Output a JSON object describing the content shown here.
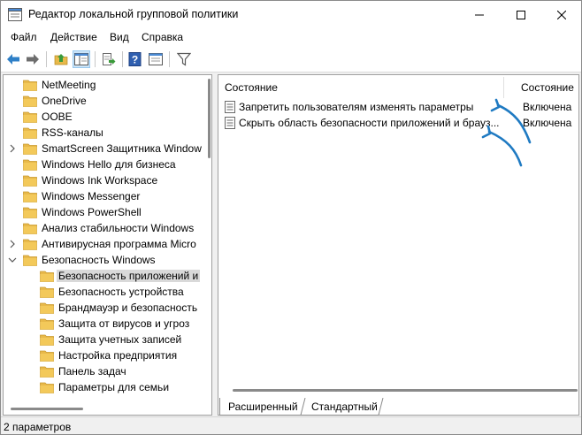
{
  "window": {
    "title": "Редактор локальной групповой политики"
  },
  "menu": [
    "Файл",
    "Действие",
    "Вид",
    "Справка"
  ],
  "toolbar": {
    "icons": [
      "back-arrow",
      "forward-arrow",
      "up-folder",
      "show-hide-tree",
      "export-list",
      "help",
      "extended-view",
      "filter"
    ]
  },
  "tree": {
    "items": [
      {
        "label": "NetMeeting",
        "expandable": false,
        "level": 1
      },
      {
        "label": "OneDrive",
        "expandable": false,
        "level": 1
      },
      {
        "label": "OOBE",
        "expandable": false,
        "level": 1
      },
      {
        "label": "RSS-каналы",
        "expandable": false,
        "level": 1
      },
      {
        "label": "SmartScreen Защитника Window",
        "expandable": true,
        "level": 1
      },
      {
        "label": "Windows Hello для бизнеса",
        "expandable": false,
        "level": 1
      },
      {
        "label": "Windows Ink Workspace",
        "expandable": false,
        "level": 1
      },
      {
        "label": "Windows Messenger",
        "expandable": false,
        "level": 1
      },
      {
        "label": "Windows PowerShell",
        "expandable": false,
        "level": 1
      },
      {
        "label": "Анализ стабильности Windows",
        "expandable": false,
        "level": 1
      },
      {
        "label": "Антивирусная программа Micro",
        "expandable": true,
        "level": 1
      },
      {
        "label": "Безопасность Windows",
        "expandable": true,
        "expanded": true,
        "level": 1
      },
      {
        "label": "Безопасность приложений и",
        "expandable": false,
        "level": 2,
        "selected": true
      },
      {
        "label": "Безопасность устройства",
        "expandable": false,
        "level": 2
      },
      {
        "label": "Брандмауэр и безопасность",
        "expandable": false,
        "level": 2
      },
      {
        "label": "Защита от вирусов и угроз",
        "expandable": false,
        "level": 2
      },
      {
        "label": "Защита учетных записей",
        "expandable": false,
        "level": 2
      },
      {
        "label": "Настройка предприятия",
        "expandable": false,
        "level": 2
      },
      {
        "label": "Панель задач",
        "expandable": false,
        "level": 2
      },
      {
        "label": "Параметры для семьи",
        "expandable": false,
        "level": 2
      }
    ]
  },
  "policies": {
    "header_name": "Состояние",
    "header_state": "Состояние",
    "rows": [
      {
        "name": "Запретить пользователям изменять параметры",
        "state": "Включена"
      },
      {
        "name": "Скрыть область безопасности приложений и брауз...",
        "state": "Включена"
      }
    ]
  },
  "tabs": [
    "Расширенный",
    "Стандартный"
  ],
  "status": {
    "text": "2 параметров"
  },
  "colors": {
    "arrow": "#1f7ac2",
    "folder": "#e8b94a",
    "selection": "#d9d9d9"
  }
}
